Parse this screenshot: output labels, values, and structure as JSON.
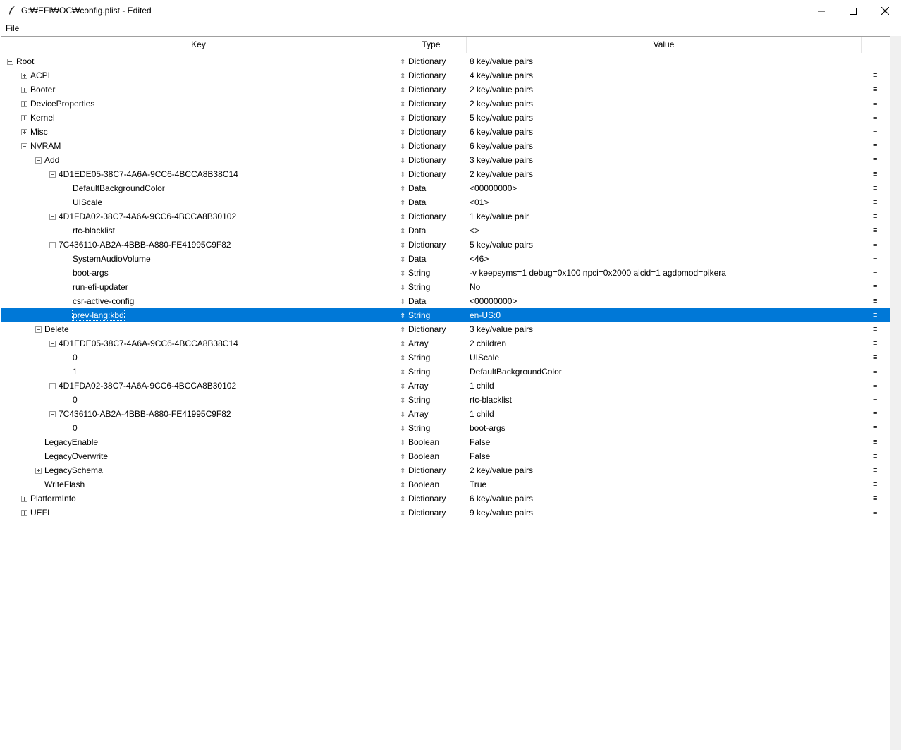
{
  "window": {
    "title": "G:₩EFI₩OC₩config.plist - Edited"
  },
  "menu": {
    "file": "File"
  },
  "columns": {
    "key": "Key",
    "type": "Type",
    "value": "Value"
  },
  "rows": [
    {
      "key": "Root",
      "depth": 0,
      "expander": "minus",
      "type": "Dictionary",
      "value": "8 key/value pairs",
      "menu": false
    },
    {
      "key": "ACPI",
      "depth": 1,
      "expander": "plus",
      "type": "Dictionary",
      "value": "4 key/value pairs",
      "menu": true
    },
    {
      "key": "Booter",
      "depth": 1,
      "expander": "plus",
      "type": "Dictionary",
      "value": "2 key/value pairs",
      "menu": true
    },
    {
      "key": "DeviceProperties",
      "depth": 1,
      "expander": "plus",
      "type": "Dictionary",
      "value": "2 key/value pairs",
      "menu": true
    },
    {
      "key": "Kernel",
      "depth": 1,
      "expander": "plus",
      "type": "Dictionary",
      "value": "5 key/value pairs",
      "menu": true
    },
    {
      "key": "Misc",
      "depth": 1,
      "expander": "plus",
      "type": "Dictionary",
      "value": "6 key/value pairs",
      "menu": true
    },
    {
      "key": "NVRAM",
      "depth": 1,
      "expander": "minus",
      "type": "Dictionary",
      "value": "6 key/value pairs",
      "menu": true
    },
    {
      "key": "Add",
      "depth": 2,
      "expander": "minus",
      "type": "Dictionary",
      "value": "3 key/value pairs",
      "menu": true
    },
    {
      "key": "4D1EDE05-38C7-4A6A-9CC6-4BCCA8B38C14",
      "depth": 3,
      "expander": "minus",
      "type": "Dictionary",
      "value": "2 key/value pairs",
      "menu": true
    },
    {
      "key": "DefaultBackgroundColor",
      "depth": 4,
      "expander": "",
      "type": "Data",
      "value": "<00000000>",
      "menu": true
    },
    {
      "key": "UIScale",
      "depth": 4,
      "expander": "",
      "type": "Data",
      "value": "<01>",
      "menu": true
    },
    {
      "key": "4D1FDA02-38C7-4A6A-9CC6-4BCCA8B30102",
      "depth": 3,
      "expander": "minus",
      "type": "Dictionary",
      "value": "1 key/value pair",
      "menu": true
    },
    {
      "key": "rtc-blacklist",
      "depth": 4,
      "expander": "",
      "type": "Data",
      "value": "<>",
      "menu": true
    },
    {
      "key": "7C436110-AB2A-4BBB-A880-FE41995C9F82",
      "depth": 3,
      "expander": "minus",
      "type": "Dictionary",
      "value": "5 key/value pairs",
      "menu": true
    },
    {
      "key": "SystemAudioVolume",
      "depth": 4,
      "expander": "",
      "type": "Data",
      "value": "<46>",
      "menu": true
    },
    {
      "key": "boot-args",
      "depth": 4,
      "expander": "",
      "type": "String",
      "value": "-v keepsyms=1 debug=0x100 npci=0x2000 alcid=1 agdpmod=pikera",
      "menu": true
    },
    {
      "key": "run-efi-updater",
      "depth": 4,
      "expander": "",
      "type": "String",
      "value": "No",
      "menu": true
    },
    {
      "key": "csr-active-config",
      "depth": 4,
      "expander": "",
      "type": "Data",
      "value": "<00000000>",
      "menu": true
    },
    {
      "key": "prev-lang:kbd",
      "depth": 4,
      "expander": "",
      "type": "String",
      "value": "en-US:0",
      "menu": true,
      "selected": true
    },
    {
      "key": "Delete",
      "depth": 2,
      "expander": "minus",
      "type": "Dictionary",
      "value": "3 key/value pairs",
      "menu": true
    },
    {
      "key": "4D1EDE05-38C7-4A6A-9CC6-4BCCA8B38C14",
      "depth": 3,
      "expander": "minus",
      "type": "Array",
      "value": "2 children",
      "menu": true
    },
    {
      "key": "0",
      "depth": 4,
      "expander": "",
      "type": "String",
      "value": "UIScale",
      "menu": true
    },
    {
      "key": "1",
      "depth": 4,
      "expander": "",
      "type": "String",
      "value": "DefaultBackgroundColor",
      "menu": true
    },
    {
      "key": "4D1FDA02-38C7-4A6A-9CC6-4BCCA8B30102",
      "depth": 3,
      "expander": "minus",
      "type": "Array",
      "value": "1 child",
      "menu": true
    },
    {
      "key": "0",
      "depth": 4,
      "expander": "",
      "type": "String",
      "value": "rtc-blacklist",
      "menu": true
    },
    {
      "key": "7C436110-AB2A-4BBB-A880-FE41995C9F82",
      "depth": 3,
      "expander": "minus",
      "type": "Array",
      "value": "1 child",
      "menu": true
    },
    {
      "key": "0",
      "depth": 4,
      "expander": "",
      "type": "String",
      "value": "boot-args",
      "menu": true
    },
    {
      "key": "LegacyEnable",
      "depth": 2,
      "expander": "",
      "type": "Boolean",
      "value": "False",
      "menu": true
    },
    {
      "key": "LegacyOverwrite",
      "depth": 2,
      "expander": "",
      "type": "Boolean",
      "value": "False",
      "menu": true
    },
    {
      "key": "LegacySchema",
      "depth": 2,
      "expander": "plus",
      "type": "Dictionary",
      "value": "2 key/value pairs",
      "menu": true
    },
    {
      "key": "WriteFlash",
      "depth": 2,
      "expander": "",
      "type": "Boolean",
      "value": "True",
      "menu": true
    },
    {
      "key": "PlatformInfo",
      "depth": 1,
      "expander": "plus",
      "type": "Dictionary",
      "value": "6 key/value pairs",
      "menu": true
    },
    {
      "key": "UEFI",
      "depth": 1,
      "expander": "plus",
      "type": "Dictionary",
      "value": "9 key/value pairs",
      "menu": true
    }
  ],
  "colors": {
    "selection": "#0078d7"
  },
  "icons": {
    "sort": "up-down-arrow-icon",
    "row_menu": "hamburger-icon"
  }
}
